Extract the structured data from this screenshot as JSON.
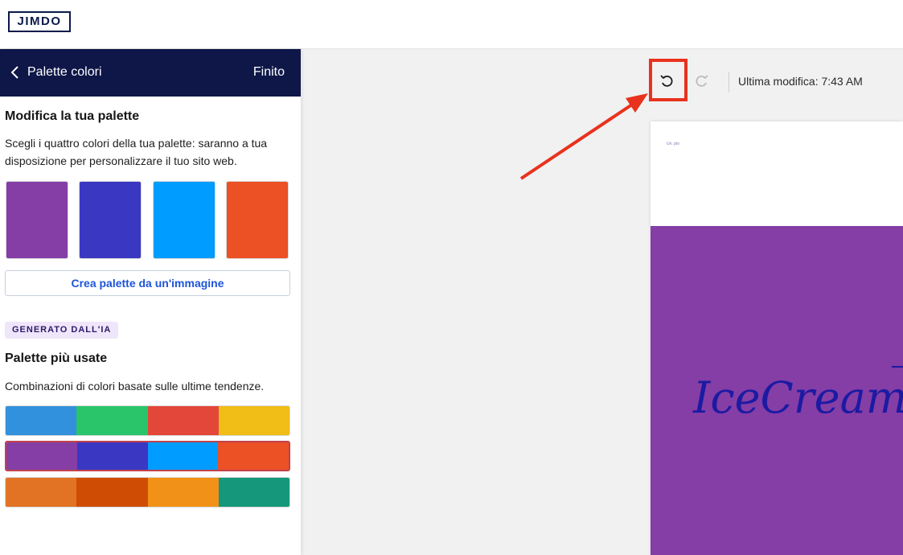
{
  "app": {
    "logo_text": "JIMDO"
  },
  "sidebar": {
    "title": "Palette colori",
    "done_label": "Finito",
    "edit_section": {
      "title": "Modifica la tua palette",
      "description": "Scegli i quattro colori della tua palette: saranno a tua disposizione per personalizzare il tuo sito web.",
      "swatches": [
        "#843ea6",
        "#3a37c2",
        "#009cff",
        "#ec5025"
      ],
      "image_button_label": "Crea palette da un'immagine"
    },
    "ai_badge": "GENERATO DALL'IA",
    "popular_section": {
      "title": "Palette più usate",
      "description": "Combinazioni di colori basate sulle ultime tendenze.",
      "palettes": [
        {
          "colors": [
            "#3291dc",
            "#2ac46b",
            "#e3473a",
            "#f1bd17"
          ],
          "selected": false
        },
        {
          "colors": [
            "#843ea6",
            "#3a37c2",
            "#009cff",
            "#ec5025"
          ],
          "selected": true
        },
        {
          "colors": [
            "#e27324",
            "#cf4c04",
            "#f29118",
            "#15977c"
          ],
          "selected": false
        }
      ]
    }
  },
  "toolbar": {
    "undo_icon": "undo-icon",
    "redo_icon": "redo-icon",
    "last_modified": "Ultima modifica: 7:43 AM",
    "highlight_color": "#e8321d"
  },
  "preview": {
    "logo_text": "Un. pio",
    "hero_title": "IceCream",
    "hero_bg": "#843ea6",
    "hero_text_color": "#1c1aa2"
  }
}
